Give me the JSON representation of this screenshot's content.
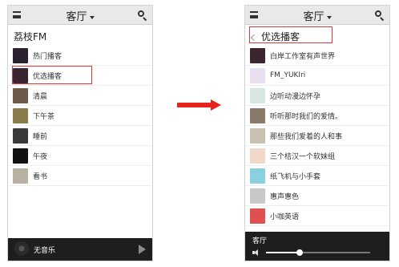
{
  "left_screen": {
    "header_title": "客厅",
    "section_title": "荔枝FM",
    "items": [
      {
        "label": "热门播客",
        "thumb_color": "#2a2030"
      },
      {
        "label": "优选播客",
        "thumb_color": "#3b2530"
      },
      {
        "label": "清晨",
        "thumb_color": "#6f5a4a"
      },
      {
        "label": "下午茶",
        "thumb_color": "#8b7a4a"
      },
      {
        "label": "睡前",
        "thumb_color": "#3a3a3a"
      },
      {
        "label": "午夜",
        "thumb_color": "#111111"
      },
      {
        "label": "看书",
        "thumb_color": "#b8b0a0"
      }
    ],
    "player_label": "无音乐"
  },
  "right_screen": {
    "header_title": "客厅",
    "back_title": "优选播客",
    "items": [
      {
        "label": "白岸工作室有声世界",
        "thumb_color": "#3b2530"
      },
      {
        "label": "FM_YUKIri",
        "thumb_color": "#e8e0f0"
      },
      {
        "label": "边听动漫边怀孕",
        "thumb_color": "#d8e8e0"
      },
      {
        "label": "听听那时我们的爱情。",
        "thumb_color": "#8a7a6a"
      },
      {
        "label": "那些我们爱着的人和事",
        "thumb_color": "#c8c0b0"
      },
      {
        "label": "三个桔汉一个软妹组",
        "thumb_color": "#f0d8c8"
      },
      {
        "label": "纸飞机与小手套",
        "thumb_color": "#8ad0e0"
      },
      {
        "label": "惠声惠色",
        "thumb_color": "#c8c8c8"
      },
      {
        "label": "小咖英语",
        "thumb_color": "#e05050"
      }
    ],
    "now_playing": "客厅",
    "volume_level": 0.32
  },
  "colors": {
    "highlight": "#e0393b",
    "arrow": "#e8231e",
    "player_bg": "#1e1e1e",
    "topbar_bg": "#e9e9e9"
  },
  "icons": [
    "menu-icon",
    "chevron-down-icon",
    "search-icon",
    "play-icon",
    "back-icon",
    "volume-icon",
    "arrow-right-icon"
  ]
}
